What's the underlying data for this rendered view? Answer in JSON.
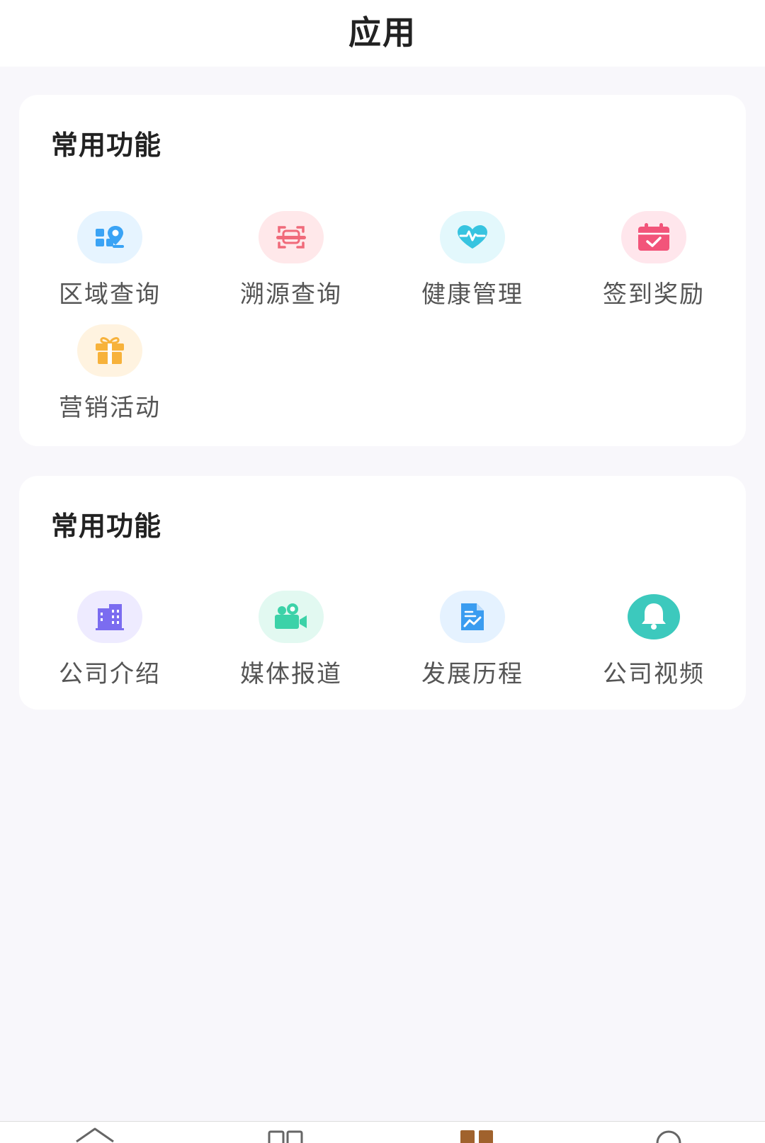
{
  "header": {
    "title": "应用"
  },
  "sections": [
    {
      "title": "常用功能",
      "items": [
        {
          "label": "区域查询",
          "icon": "map-location-icon",
          "color": "#3aa3f5",
          "bg": "#e6f4ff"
        },
        {
          "label": "溯源查询",
          "icon": "scan-icon",
          "color": "#f06a7a",
          "bg": "#ffe8ea"
        },
        {
          "label": "健康管理",
          "icon": "heart-pulse-icon",
          "color": "#37c4e0",
          "bg": "#e3f8fc"
        },
        {
          "label": "签到奖励",
          "icon": "calendar-check-icon",
          "color": "#f2547a",
          "bg": "#ffe6ec"
        },
        {
          "label": "营销活动",
          "icon": "gift-icon",
          "color": "#f7b23b",
          "bg": "#fff3e0"
        }
      ]
    },
    {
      "title": "常用功能",
      "items": [
        {
          "label": "公司介绍",
          "icon": "building-icon",
          "color": "#7b6cf0",
          "bg": "#eeebff"
        },
        {
          "label": "媒体报道",
          "icon": "video-camera-icon",
          "color": "#3cd2a8",
          "bg": "#e2f9f1"
        },
        {
          "label": "发展历程",
          "icon": "document-chart-icon",
          "color": "#3a9cf0",
          "bg": "#e5f2ff"
        },
        {
          "label": "公司视频",
          "icon": "bell-icon",
          "color": "#3cc9bd",
          "bg": "#ffffff"
        }
      ]
    }
  ],
  "tabbar": {
    "items": [
      {
        "icon": "home-icon",
        "color": "#666666"
      },
      {
        "icon": "grid-icon",
        "color": "#666666"
      },
      {
        "icon": "apps-icon",
        "color": "#a0622d"
      },
      {
        "icon": "user-icon",
        "color": "#666666"
      }
    ]
  }
}
